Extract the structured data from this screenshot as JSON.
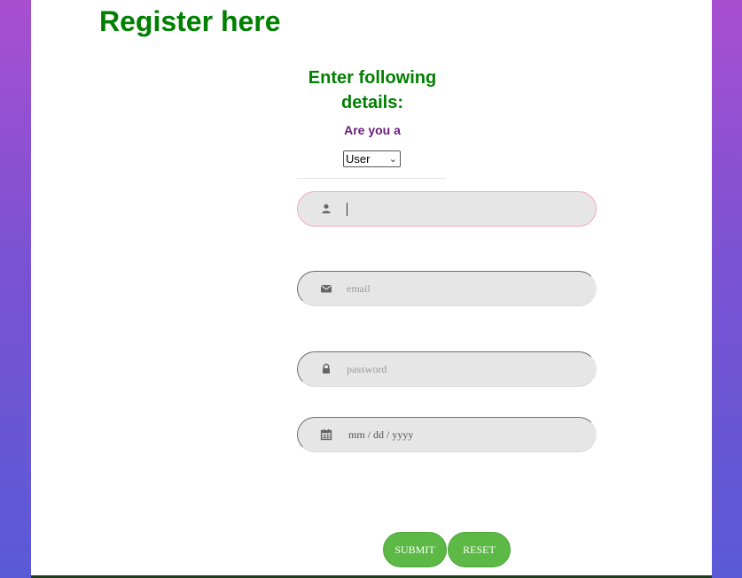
{
  "header": {
    "title": "Register here"
  },
  "form": {
    "heading": "Enter following details:",
    "role_label": "Are you a",
    "role_select": {
      "selected": "User"
    },
    "fields": {
      "username": {
        "value": "",
        "placeholder": ""
      },
      "email": {
        "placeholder": "email"
      },
      "password": {
        "placeholder": "password"
      },
      "date": {
        "placeholder": "mm / dd / yyyy"
      }
    },
    "buttons": {
      "submit": "SUBMIT",
      "reset": "RESET"
    }
  },
  "icons": {
    "username": "user-icon",
    "email": "envelope-icon",
    "password": "lock-icon",
    "date": "calendar-icon"
  },
  "colors": {
    "heading": "#008000",
    "label": "#6a1b7a",
    "button": "#5cb946",
    "field_bg": "#e6e6e6",
    "focus_border": "#f3a9c4"
  }
}
